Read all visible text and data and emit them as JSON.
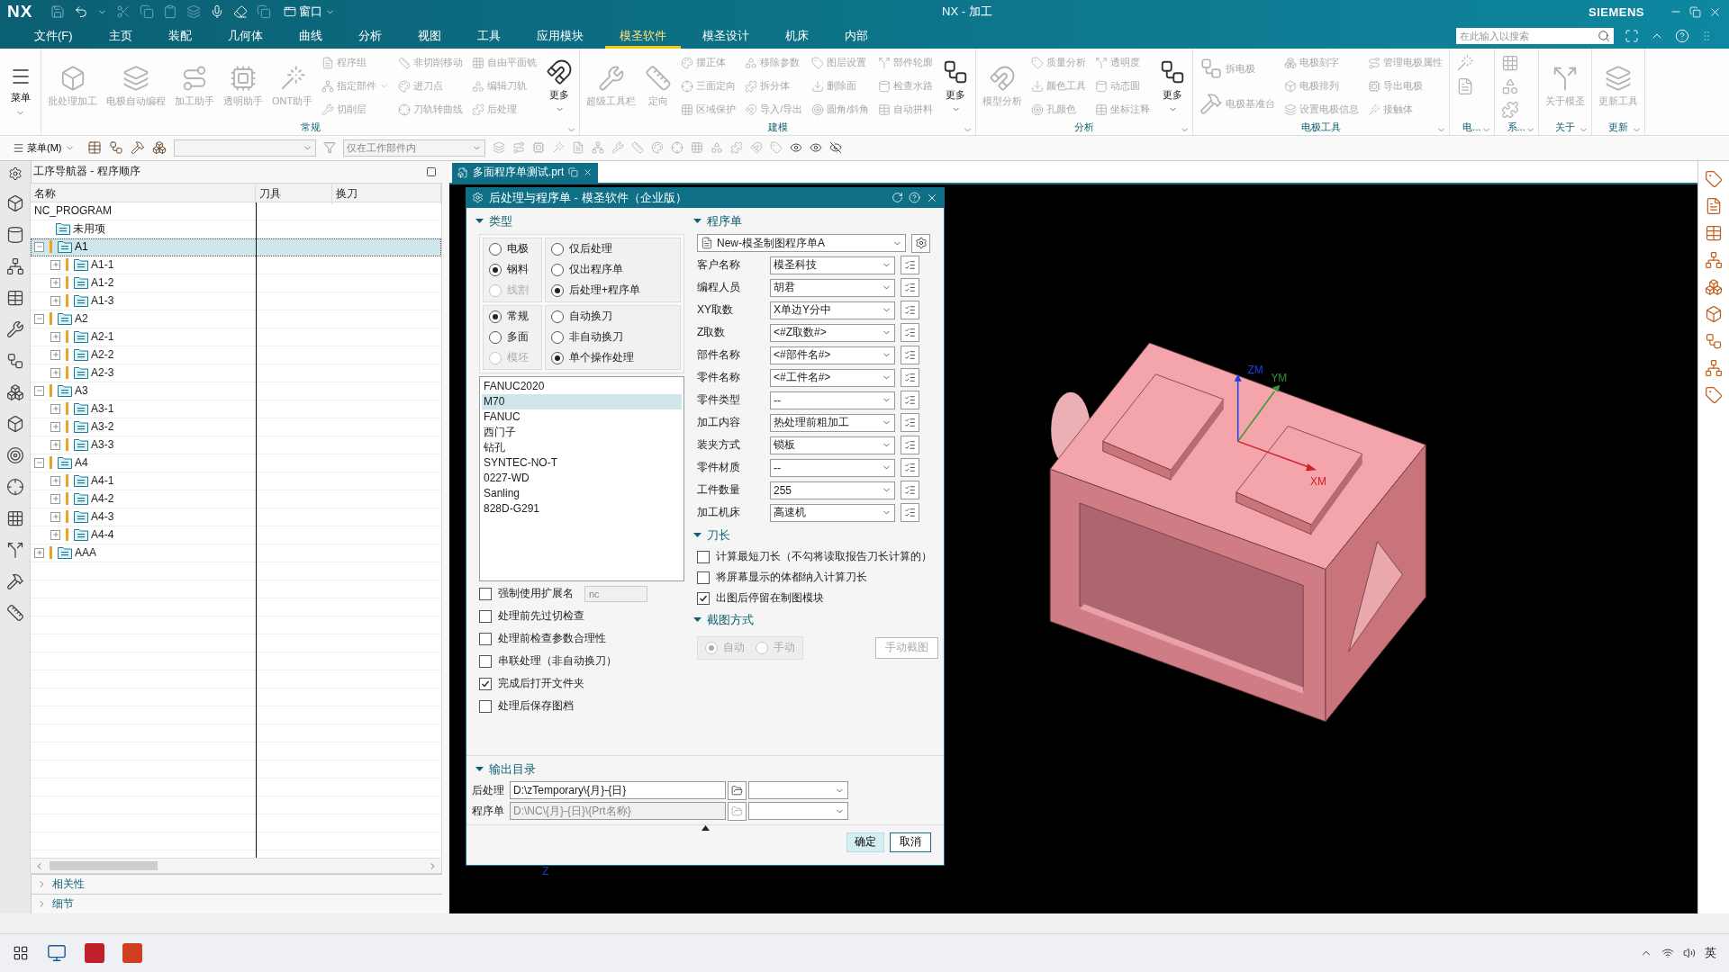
{
  "title_bar": {
    "logo": "NX",
    "window_menu": "窗口",
    "title": "NX - 加工",
    "brand": "SIEMENS"
  },
  "menu_tabs": [
    {
      "label": "文件(F)",
      "selected": false
    },
    {
      "label": "主页",
      "selected": false
    },
    {
      "label": "装配",
      "selected": false
    },
    {
      "label": "几何体",
      "selected": false
    },
    {
      "label": "曲线",
      "selected": false
    },
    {
      "label": "分析",
      "selected": false
    },
    {
      "label": "视图",
      "selected": false
    },
    {
      "label": "工具",
      "selected": false
    },
    {
      "label": "应用模块",
      "selected": false
    },
    {
      "label": "模圣软件",
      "selected": true
    },
    {
      "label": "模圣设计",
      "selected": false
    },
    {
      "label": "机床",
      "selected": false
    },
    {
      "label": "内部",
      "selected": false
    }
  ],
  "search": {
    "placeholder": "在此输入以搜索"
  },
  "ribbon": {
    "menu_button": {
      "label": "菜单"
    },
    "groups": [
      {
        "label": "常规",
        "items": [
          {
            "label": "批处理加工",
            "kind": "large",
            "disabled": true
          },
          {
            "label": "电极自动编程",
            "kind": "large",
            "disabled": true
          },
          {
            "label": "加工助手",
            "kind": "large",
            "disabled": true
          },
          {
            "label": "透明助手",
            "kind": "large",
            "disabled": true
          },
          {
            "label": "ONT助手",
            "kind": "large",
            "disabled": true
          },
          {
            "label": "程序组",
            "kind": "small",
            "disabled": true
          },
          {
            "label": "指定部件",
            "kind": "small",
            "disabled": true,
            "dropdown": true
          },
          {
            "label": "切削层",
            "kind": "small",
            "disabled": true
          },
          {
            "label": "非切削移动",
            "kind": "small",
            "disabled": true
          },
          {
            "label": "进刀点",
            "kind": "small",
            "disabled": true
          },
          {
            "label": "刀轨转曲线",
            "kind": "small",
            "disabled": true
          },
          {
            "label": "自由平面铣",
            "kind": "small",
            "disabled": true
          },
          {
            "label": "编辑刀轨",
            "kind": "small",
            "disabled": true
          },
          {
            "label": "后处理",
            "kind": "small",
            "disabled": true
          },
          {
            "label": "更多",
            "kind": "large",
            "disabled": false,
            "dropdown": true
          }
        ]
      },
      {
        "label": "建模",
        "items": [
          {
            "label": "超级工具栏",
            "kind": "large",
            "disabled": true
          },
          {
            "label": "定向",
            "kind": "large",
            "disabled": true
          },
          {
            "label": "摆正体",
            "kind": "small",
            "disabled": true
          },
          {
            "label": "三面定向",
            "kind": "small",
            "disabled": true
          },
          {
            "label": "区域保护",
            "kind": "small",
            "disabled": true
          },
          {
            "label": "移除参数",
            "kind": "small",
            "disabled": true
          },
          {
            "label": "拆分体",
            "kind": "small",
            "disabled": true
          },
          {
            "label": "导入/导出",
            "kind": "small",
            "disabled": true
          },
          {
            "label": "图层设置",
            "kind": "small",
            "disabled": true
          },
          {
            "label": "删除面",
            "kind": "small",
            "disabled": true
          },
          {
            "label": "圆角/斜角",
            "kind": "small",
            "disabled": true
          },
          {
            "label": "部件轮廓",
            "kind": "small",
            "disabled": true
          },
          {
            "label": "检查水路",
            "kind": "small",
            "disabled": true
          },
          {
            "label": "自动拼料",
            "kind": "small",
            "disabled": true
          },
          {
            "label": "更多",
            "kind": "large",
            "disabled": false,
            "dropdown": true
          }
        ]
      },
      {
        "label": "分析",
        "items": [
          {
            "label": "模型分析",
            "kind": "large",
            "disabled": true
          },
          {
            "label": "质量分析",
            "kind": "small",
            "disabled": true
          },
          {
            "label": "颜色工具",
            "kind": "small",
            "disabled": true
          },
          {
            "label": "孔颜色",
            "kind": "small",
            "disabled": true
          },
          {
            "label": "透明度",
            "kind": "small",
            "disabled": true
          },
          {
            "label": "动态圆",
            "kind": "small",
            "disabled": true
          },
          {
            "label": "坐标注释",
            "kind": "small",
            "disabled": true
          },
          {
            "label": "更多",
            "kind": "large",
            "disabled": false,
            "dropdown": true
          }
        ]
      },
      {
        "label": "电极工具",
        "items": [
          {
            "label": "拆电极",
            "kind": "wide",
            "disabled": true
          },
          {
            "label": "电极基准台",
            "kind": "wide",
            "disabled": true
          },
          {
            "label": "电极刻字",
            "kind": "small",
            "disabled": true
          },
          {
            "label": "电极排列",
            "kind": "small",
            "disabled": true
          },
          {
            "label": "设置电极信息",
            "kind": "small",
            "disabled": true
          },
          {
            "label": "管理电极属性",
            "kind": "small",
            "disabled": true
          },
          {
            "label": "导出电极",
            "kind": "small",
            "disabled": true
          },
          {
            "label": "接触体",
            "kind": "small",
            "disabled": true
          }
        ]
      },
      {
        "label": "电...",
        "items": [
          {
            "kind": "icon",
            "disabled": true
          },
          {
            "kind": "icon",
            "disabled": true
          }
        ]
      },
      {
        "label": "系...",
        "items": [
          {
            "kind": "icon",
            "disabled": true
          },
          {
            "kind": "icon",
            "disabled": true
          },
          {
            "kind": "icon",
            "disabled": true
          }
        ]
      },
      {
        "label": "关于",
        "items": [
          {
            "label": "关于模圣",
            "kind": "large",
            "disabled": true
          }
        ]
      },
      {
        "label": "更新",
        "items": [
          {
            "label": "更新工具",
            "kind": "large",
            "disabled": true
          }
        ]
      }
    ]
  },
  "toolbar": {
    "menu": "菜单(M)",
    "scope": "仅在工作部件内"
  },
  "navigator": {
    "title": "工序导航器 - 程序顺序",
    "columns": [
      "名称",
      "刀具",
      "换刀"
    ],
    "tree": [
      {
        "label": "NC_PROGRAM",
        "selected": false,
        "children": [
          {
            "label": "未用项",
            "selected": false
          },
          {
            "label": "A1",
            "selected": true,
            "expanded": true,
            "regen_needed": true,
            "children": [
              {
                "label": "A1-1",
                "selected": false,
                "expanded": false,
                "regen_needed": true
              },
              {
                "label": "A1-2",
                "selected": false,
                "expanded": false,
                "regen_needed": true
              },
              {
                "label": "A1-3",
                "selected": false,
                "expanded": false,
                "regen_needed": true
              }
            ]
          },
          {
            "label": "A2",
            "selected": false,
            "expanded": true,
            "regen_needed": true,
            "children": [
              {
                "label": "A2-1",
                "selected": false,
                "expanded": false,
                "regen_needed": true
              },
              {
                "label": "A2-2",
                "selected": false,
                "expanded": false,
                "regen_needed": true
              },
              {
                "label": "A2-3",
                "selected": false,
                "expanded": false,
                "regen_needed": true
              }
            ]
          },
          {
            "label": "A3",
            "selected": false,
            "expanded": true,
            "regen_needed": true,
            "children": [
              {
                "label": "A3-1",
                "selected": false,
                "expanded": false,
                "regen_needed": true
              },
              {
                "label": "A3-2",
                "selected": false,
                "expanded": false,
                "regen_needed": true
              },
              {
                "label": "A3-3",
                "selected": false,
                "expanded": false,
                "regen_needed": true
              }
            ]
          },
          {
            "label": "A4",
            "selected": false,
            "expanded": true,
            "regen_needed": true,
            "children": [
              {
                "label": "A4-1",
                "selected": false,
                "expanded": false,
                "regen_needed": true
              },
              {
                "label": "A4-2",
                "selected": false,
                "expanded": false,
                "regen_needed": true
              },
              {
                "label": "A4-3",
                "selected": false,
                "expanded": false,
                "regen_needed": true
              },
              {
                "label": "A4-4",
                "selected": false,
                "expanded": false,
                "regen_needed": true
              }
            ]
          },
          {
            "label": "AAA",
            "selected": false,
            "expanded": false,
            "regen_needed": true
          }
        ]
      }
    ],
    "panels": [
      {
        "label": "相关性",
        "expanded": false
      },
      {
        "label": "细节",
        "expanded": false
      }
    ]
  },
  "file_tab": {
    "label": "多面程序单测试.prt"
  },
  "viewport": {
    "axis_labels": [
      {
        "label": "ZM",
        "color": "#1f3fe0"
      },
      {
        "label": "YM",
        "color": "#2f9a2f"
      },
      {
        "label": "XM",
        "color": "#d02030"
      }
    ],
    "wcs_label": "Z"
  },
  "dialog": {
    "title": "后处理与程序单 - 模圣软件（企业版）",
    "type_section": {
      "title": "类型",
      "expanded": true,
      "radio_groups": [
        {
          "options": [
            {
              "label": "电极",
              "selected": false,
              "disabled": false
            },
            {
              "label": "钢料",
              "selected": true,
              "disabled": false
            },
            {
              "label": "线割",
              "selected": false,
              "disabled": true
            }
          ]
        },
        {
          "options": [
            {
              "label": "仅后处理",
              "selected": false,
              "disabled": false
            },
            {
              "label": "仅出程序单",
              "selected": false,
              "disabled": false
            },
            {
              "label": "后处理+程序单",
              "selected": true,
              "disabled": false
            }
          ]
        },
        {
          "options": [
            {
              "label": "常规",
              "selected": true,
              "disabled": false
            },
            {
              "label": "多面",
              "selected": false,
              "disabled": false
            },
            {
              "label": "模坯",
              "selected": false,
              "disabled": true
            }
          ]
        },
        {
          "options": [
            {
              "label": "自动换刀",
              "selected": false,
              "disabled": false
            },
            {
              "label": "非自动换刀",
              "selected": false,
              "disabled": false
            },
            {
              "label": "单个操作处理",
              "selected": true,
              "disabled": false
            }
          ]
        }
      ],
      "postprocessors": [
        {
          "label": "FANUC2020",
          "selected": false
        },
        {
          "label": "M70",
          "selected": true
        },
        {
          "label": "FANUC",
          "selected": false
        },
        {
          "label": "西门子",
          "selected": false
        },
        {
          "label": "钻孔",
          "selected": false
        },
        {
          "label": "SYNTEC-NO-T",
          "selected": false
        },
        {
          "label": "0227-WD",
          "selected": false
        },
        {
          "label": "Sanling",
          "selected": false
        },
        {
          "label": "828D-G291",
          "selected": false
        }
      ],
      "options": [
        {
          "label": "强制使用扩展名",
          "checked": false,
          "field": {
            "value": "nc",
            "disabled": true
          }
        },
        {
          "label": "处理前先过切检查",
          "checked": false
        },
        {
          "label": "处理前检查参数合理性",
          "checked": false
        },
        {
          "label": "串联处理（非自动换刀）",
          "checked": false
        },
        {
          "label": "完成后打开文件夹",
          "checked": true
        },
        {
          "label": "处理后保存图档",
          "checked": false
        }
      ]
    },
    "program_section": {
      "title": "程序单",
      "expanded": true,
      "template": "New-模圣制图程序单A",
      "fields": [
        {
          "label": "客户名称",
          "value": "模圣科技"
        },
        {
          "label": "编程人员",
          "value": "胡君"
        },
        {
          "label": "XY取数",
          "value": "X单边Y分中"
        },
        {
          "label": "Z取数",
          "value": "<#Z取数#>"
        },
        {
          "label": "部件名称",
          "value": "<#部件名#>"
        },
        {
          "label": "零件名称",
          "value": "<#工件名#>"
        },
        {
          "label": "零件类型",
          "value": "--"
        },
        {
          "label": "加工内容",
          "value": "热处理前粗加工"
        },
        {
          "label": "装夹方式",
          "value": "锁板"
        },
        {
          "label": "零件材质",
          "value": "--"
        },
        {
          "label": "工件数量",
          "value": "255"
        },
        {
          "label": "加工机床",
          "value": "高速机"
        }
      ]
    },
    "tool_length_section": {
      "title": "刀长",
      "expanded": true,
      "options": [
        {
          "label": "计算最短刀长（不勾将读取报告刀长计算的）",
          "checked": false
        },
        {
          "label": "将屏幕显示的体都纳入计算刀长",
          "checked": false
        },
        {
          "label": "出图后停留在制图模块",
          "checked": true
        }
      ]
    },
    "capture_section": {
      "title": "截图方式",
      "expanded": true,
      "modes": [
        {
          "label": "自动",
          "selected": true,
          "disabled": true
        },
        {
          "label": "手动",
          "selected": false,
          "disabled": true
        }
      ],
      "button": {
        "label": "手动截图",
        "disabled": true
      }
    },
    "output_section": {
      "title": "输出目录",
      "expanded": true,
      "rows": [
        {
          "label": "后处理",
          "value": "D:\\zTemporary\\{月}-{日}",
          "disabled": false
        },
        {
          "label": "程序单",
          "value": "D:\\NC\\{月}-{日}\\{Prt名称}",
          "disabled": true
        }
      ]
    },
    "buttons": [
      {
        "label": "确定",
        "kind": "primary"
      },
      {
        "label": "取消",
        "kind": "default"
      }
    ]
  },
  "taskbar": {
    "ime": "英"
  }
}
